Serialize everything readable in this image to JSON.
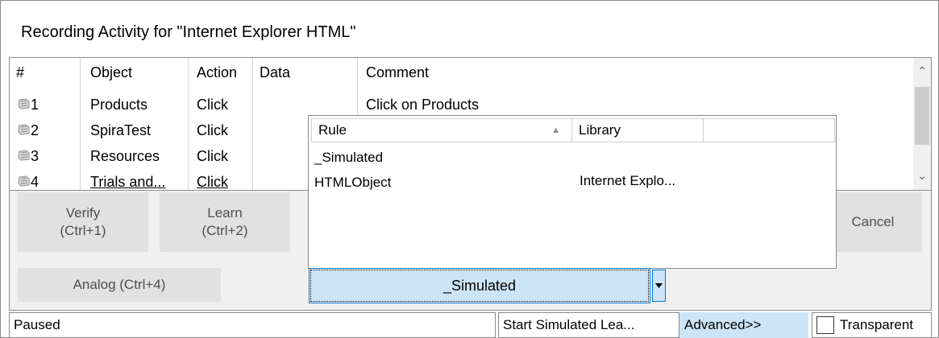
{
  "title": "Recording Activity for \"Internet Explorer HTML\"",
  "grid": {
    "headers": [
      "#",
      "Object",
      "Action",
      "Data",
      "Comment"
    ],
    "rows": [
      {
        "num": "1",
        "object": "Products",
        "action": "Click",
        "data": "",
        "comment": "Click on Products"
      },
      {
        "num": "2",
        "object": "SpiraTest",
        "action": "Click",
        "data": "",
        "comment": ""
      },
      {
        "num": "3",
        "object": "Resources",
        "action": "Click",
        "data": "",
        "comment": ""
      },
      {
        "num": "4",
        "object": "Trials and...",
        "action": "Click",
        "data": "",
        "comment": ""
      }
    ]
  },
  "buttons": {
    "verify": [
      "Verify",
      "(Ctrl+1)"
    ],
    "learn": [
      "Learn",
      "(Ctrl+2)"
    ],
    "analog": "Analog (Ctrl+4)",
    "cancel": "Cancel"
  },
  "popup": {
    "headers": [
      "Rule",
      "Library",
      ""
    ],
    "items": [
      {
        "rule": "_Simulated",
        "library": ""
      },
      {
        "rule": "HTMLObject",
        "library": "Internet Explo..."
      }
    ]
  },
  "combo": {
    "value": "_Simulated"
  },
  "status": {
    "state": "Paused",
    "action": "Start Simulated Lea...",
    "advanced": "Advanced>>",
    "transparent": "Transparent"
  },
  "colors": {
    "accent": "#0078d7",
    "selected": "#cce4f7",
    "panel": "#f0f0f0",
    "button": "#e1e1e1"
  }
}
